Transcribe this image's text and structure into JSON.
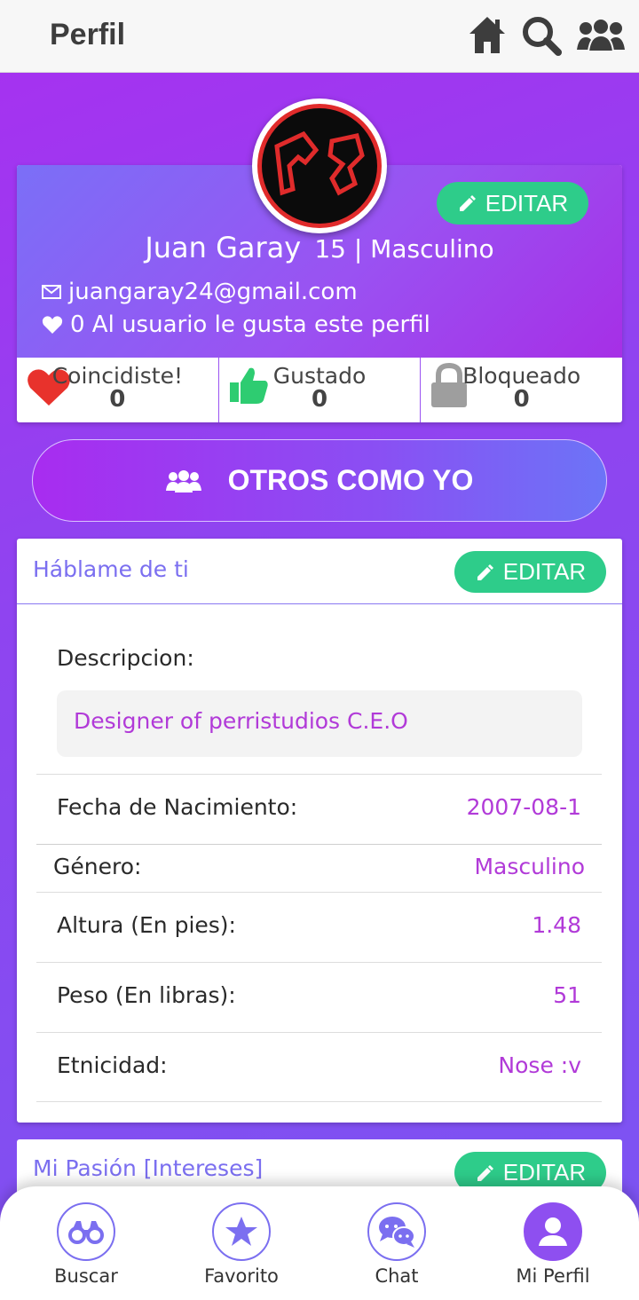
{
  "header": {
    "title": "Perfil",
    "icons": [
      "home-icon",
      "search-icon",
      "group-icon"
    ]
  },
  "profile": {
    "name": "Juan Garay",
    "age_gender": "15 | Masculino",
    "email": "juangaray24@gmail.com",
    "likes_text": "0 Al usuario le gusta este perfil",
    "edit_label": "EDITAR",
    "stats": [
      {
        "label": "Coincidiste!",
        "value": "0",
        "icon": "heart-icon"
      },
      {
        "label": "Gustado",
        "value": "0",
        "icon": "thumbs-up-icon"
      },
      {
        "label": "Bloqueado",
        "value": "0",
        "icon": "lock-icon"
      }
    ]
  },
  "others_button": {
    "label": "OTROS COMO YO"
  },
  "about": {
    "title": "Háblame de ti",
    "edit_label": "EDITAR",
    "description_label": "Descripcion:",
    "description": "Designer of perristudios C.E.O",
    "fields": [
      {
        "label": "Fecha de Nacimiento:",
        "value": "2007-08-1"
      },
      {
        "label": "Género:",
        "value": "Masculino"
      },
      {
        "label": "Altura (En pies):",
        "value": "1.48"
      },
      {
        "label": "Peso (En libras):",
        "value": "51"
      },
      {
        "label": "Etnicidad:",
        "value": "Nose :v"
      }
    ]
  },
  "passion": {
    "title": "Mi Pasión [Intereses]",
    "edit_label": "EDITAR"
  },
  "nav": {
    "items": [
      {
        "label": "Buscar",
        "icon": "binoculars-icon"
      },
      {
        "label": "Favorito",
        "icon": "star-icon"
      },
      {
        "label": "Chat",
        "icon": "chat-icon"
      },
      {
        "label": "Mi Perfil",
        "icon": "user-icon"
      }
    ],
    "active": "Mi Perfil"
  },
  "colors": {
    "accent": "#9a52f2",
    "edit_green": "#2ecc8a",
    "value_purple": "#b13ad8"
  }
}
